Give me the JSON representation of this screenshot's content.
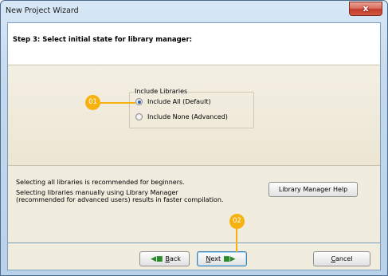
{
  "window": {
    "title": "New Project Wizard",
    "close_glyph": "x"
  },
  "header": {
    "step_title": "Step 3: Select initial state for library manager:"
  },
  "group": {
    "legend": "Include Libraries",
    "options": [
      {
        "label": "Include All (Default)",
        "checked": true
      },
      {
        "label": "Include None (Advanced)",
        "checked": false
      }
    ]
  },
  "info": {
    "line1": "Selecting all libraries is recommended for beginners.",
    "line2": "Selecting libraries manually using Library Manager",
    "line3": "(recommended for advanced users) results in faster compilation."
  },
  "help_button": "Library Manager Help",
  "buttons": {
    "back_mnemonic": "B",
    "back_rest": "ack",
    "next_mnemonic": "N",
    "next_rest": "ext",
    "cancel_mnemonic": "C",
    "cancel_rest": "ancel"
  },
  "markers": {
    "m1": "01",
    "m2": "02"
  },
  "colors": {
    "marker": "#f7b20f",
    "arrow": "#2c8a2c",
    "border": "#7f9db9"
  },
  "icons": {
    "back": "arrow-left-icon",
    "next": "arrow-right-icon"
  }
}
